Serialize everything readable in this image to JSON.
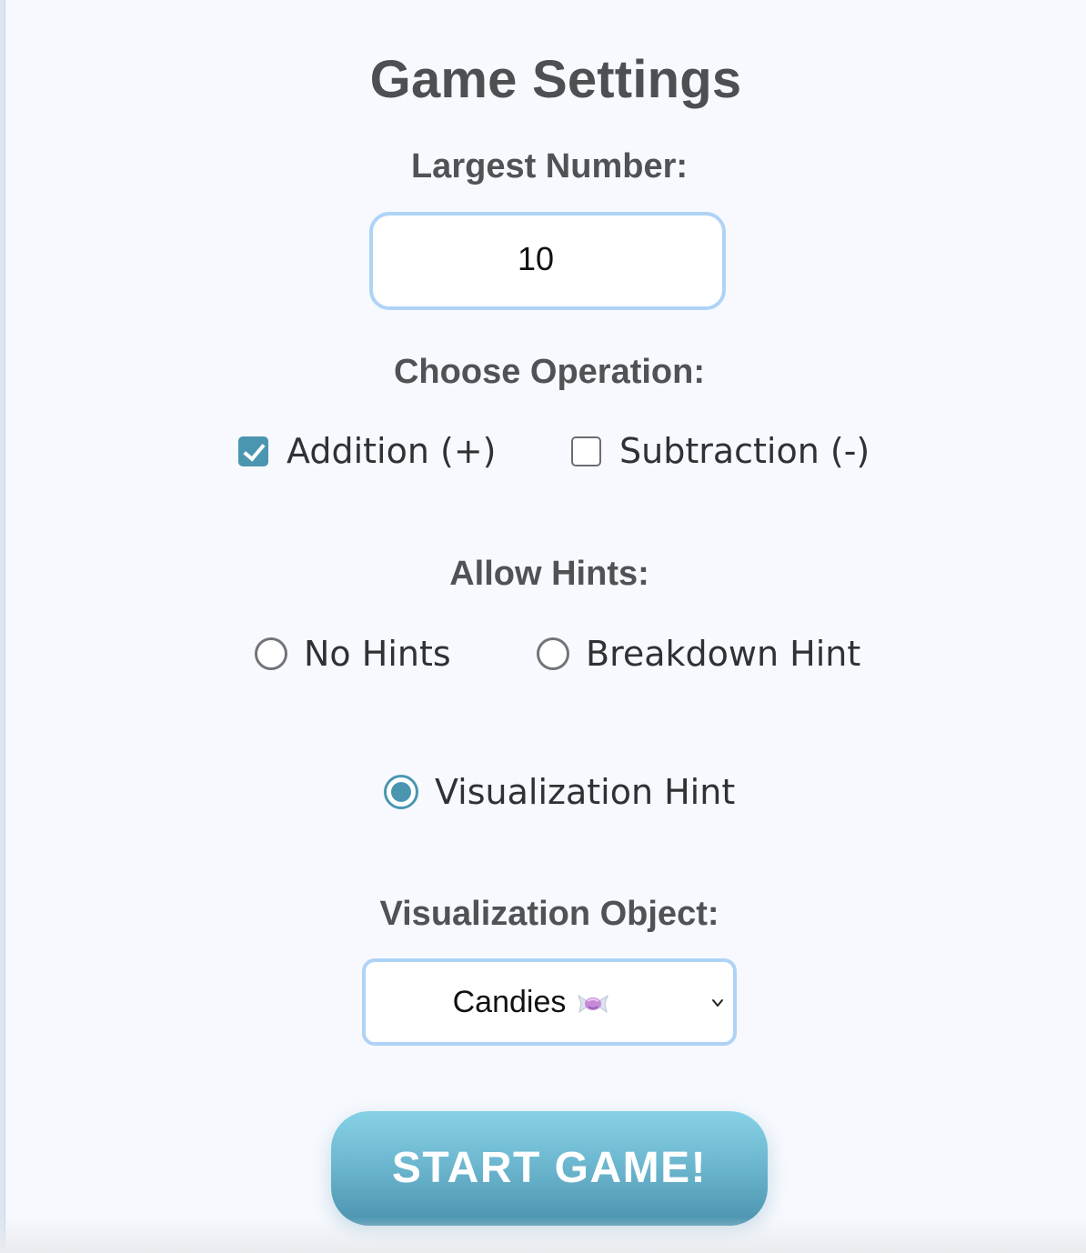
{
  "settings": {
    "title": "Game Settings",
    "largest_number_label": "Largest Number:",
    "largest_number_value": "10",
    "operation_label": "Choose Operation:",
    "operations": [
      {
        "label": "Addition (+)",
        "checked": true
      },
      {
        "label": "Subtraction (-)",
        "checked": false
      }
    ],
    "hints_label": "Allow Hints:",
    "hints": [
      {
        "label": "No Hints",
        "selected": false
      },
      {
        "label": "Breakdown Hint",
        "selected": false
      },
      {
        "label": "Visualization Hint",
        "selected": true
      }
    ],
    "visualization_label": "Visualization Object:",
    "visualization_value": "Candies",
    "visualization_icon": "candy-icon",
    "start_button_label": "START GAME!"
  },
  "colors": {
    "accent": "#4a96b0",
    "input_border": "#aed3f6",
    "background": "#f7f9fe",
    "heading": "#4d4f52"
  }
}
